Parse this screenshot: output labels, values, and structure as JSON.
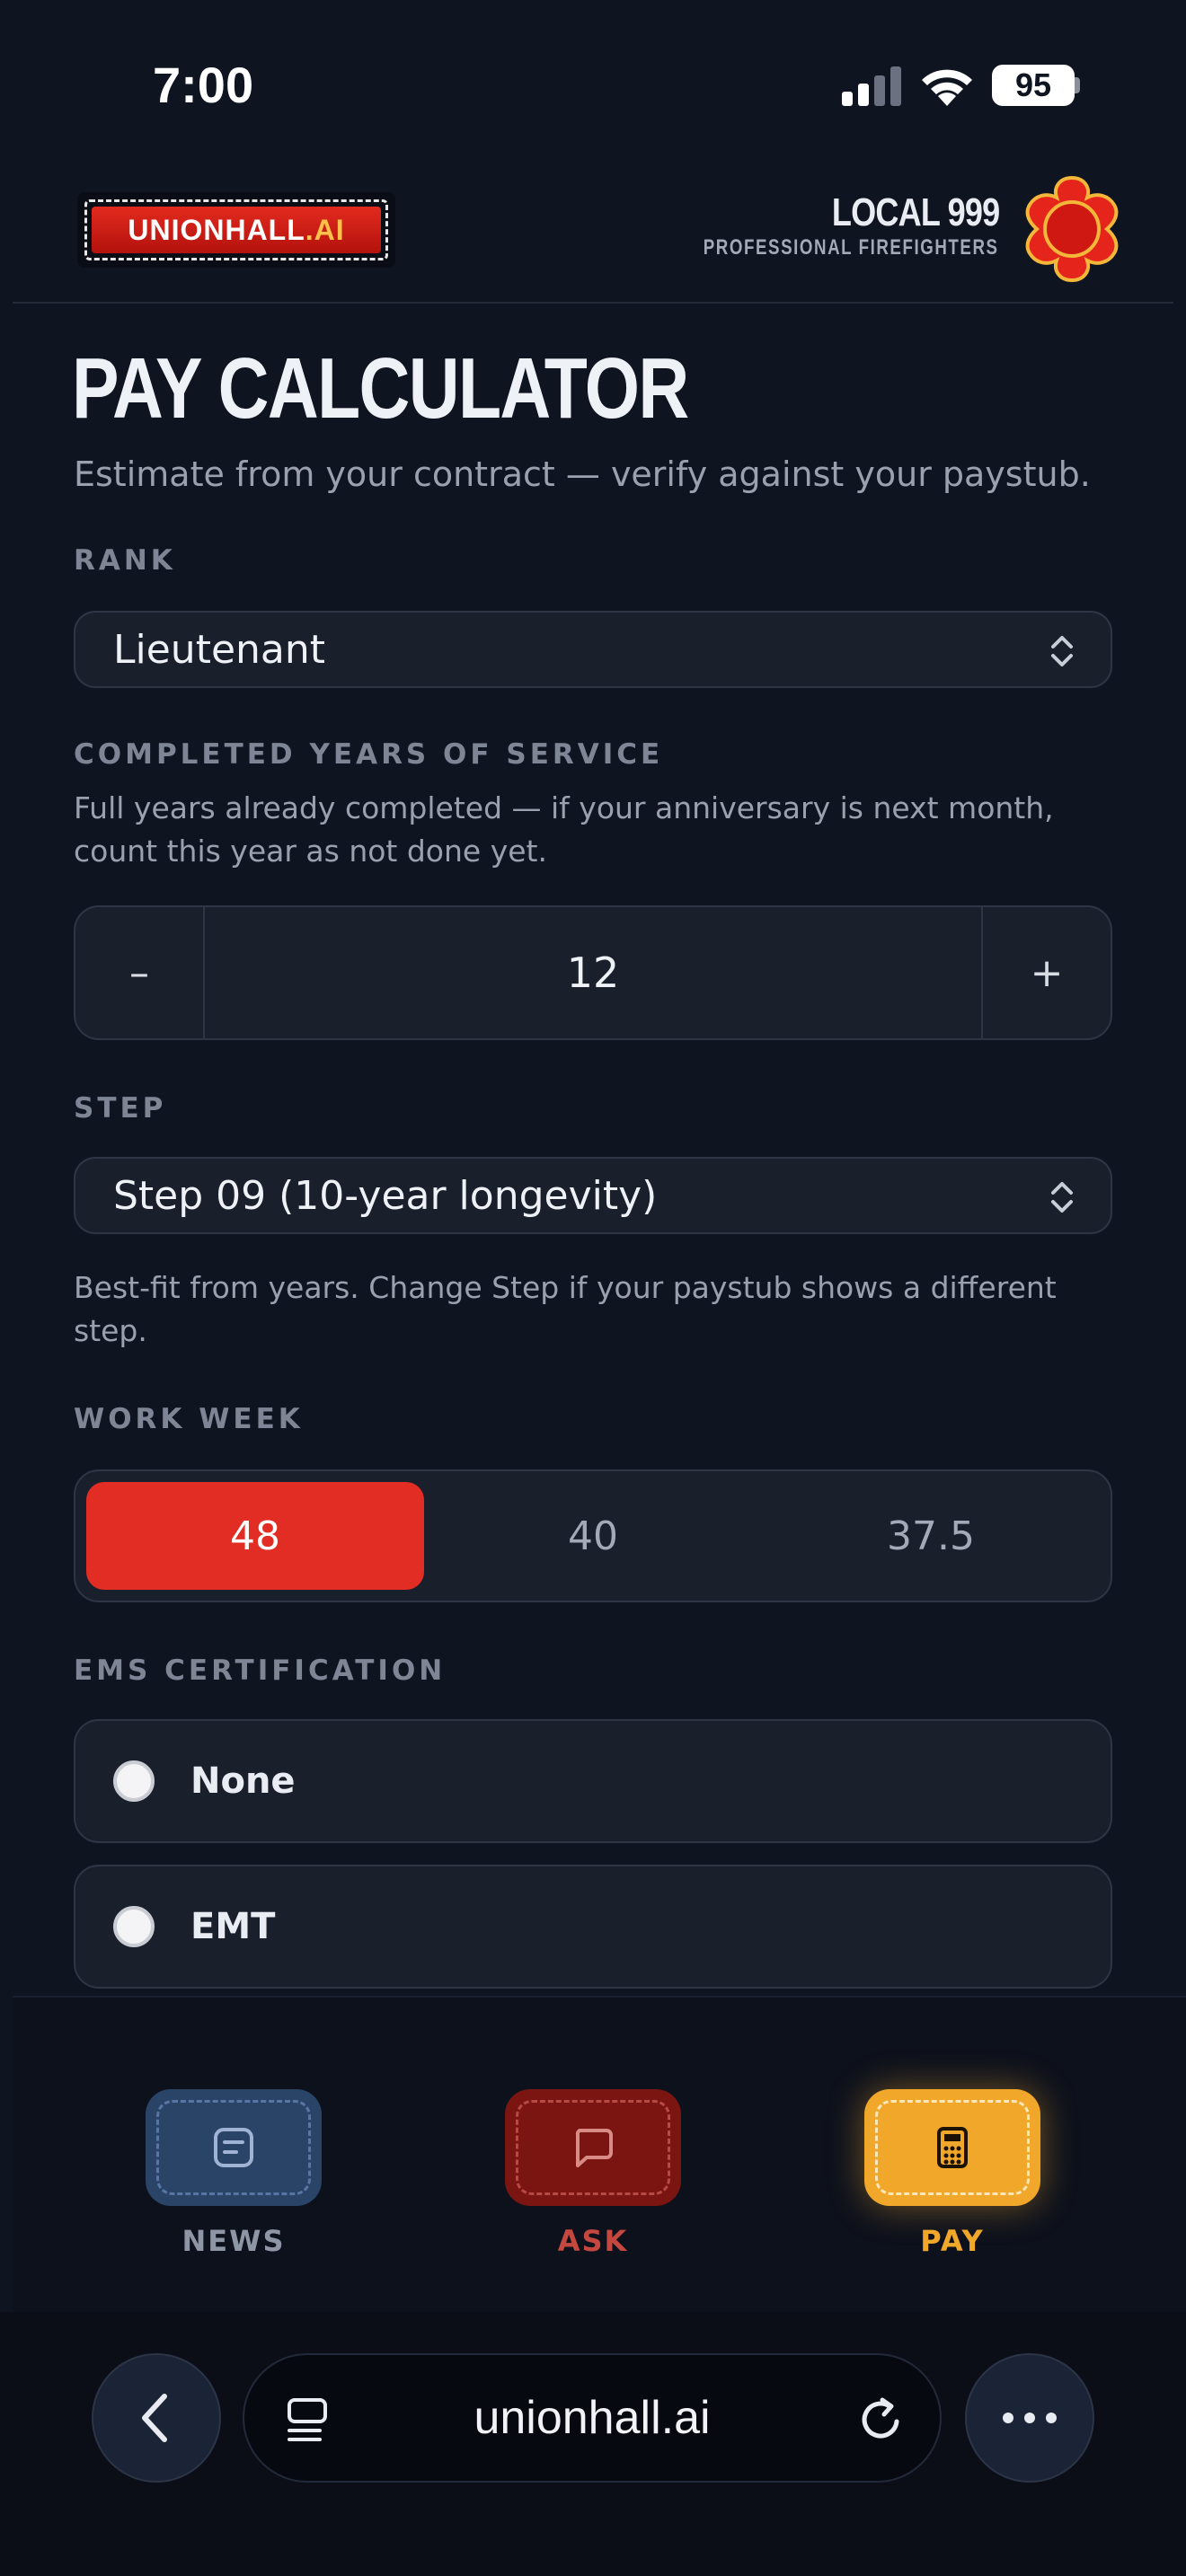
{
  "status_bar": {
    "time": "7:00",
    "battery": "95"
  },
  "header": {
    "logo_main": "UNIONHALL",
    "logo_ai": ".AI",
    "local_title": "LOCAL 999",
    "local_subtitle": "PROFESSIONAL FIREFIGHTERS"
  },
  "page": {
    "title": "PAY CALCULATOR",
    "subtitle": "Estimate from your contract — verify against your paystub."
  },
  "rank": {
    "label": "RANK",
    "value": "Lieutenant"
  },
  "years": {
    "label": "COMPLETED YEARS OF SERVICE",
    "help": "Full years already completed — if your anniversary is next month, count this year as not done yet.",
    "minus": "–",
    "value": "12",
    "plus": "+"
  },
  "step": {
    "label": "STEP",
    "value": "Step 09 (10-year longevity)",
    "help": "Best-fit from years. Change Step if your paystub shows a different step."
  },
  "work_week": {
    "label": "WORK WEEK",
    "options": [
      "48",
      "40",
      "37.5"
    ],
    "selected": "48"
  },
  "ems": {
    "label": "EMS CERTIFICATION",
    "options": [
      "None",
      "EMT"
    ]
  },
  "bottom_nav": {
    "items": [
      {
        "label": "NEWS",
        "color": "#8e96a6"
      },
      {
        "label": "ASK",
        "color": "#c4483f"
      },
      {
        "label": "PAY",
        "color": "#f0a72a"
      }
    ]
  },
  "browser": {
    "url": "unionhall.ai"
  },
  "colors": {
    "accent_red": "#e22d24",
    "accent_gold": "#f0a72a",
    "background": "#0f1421"
  }
}
